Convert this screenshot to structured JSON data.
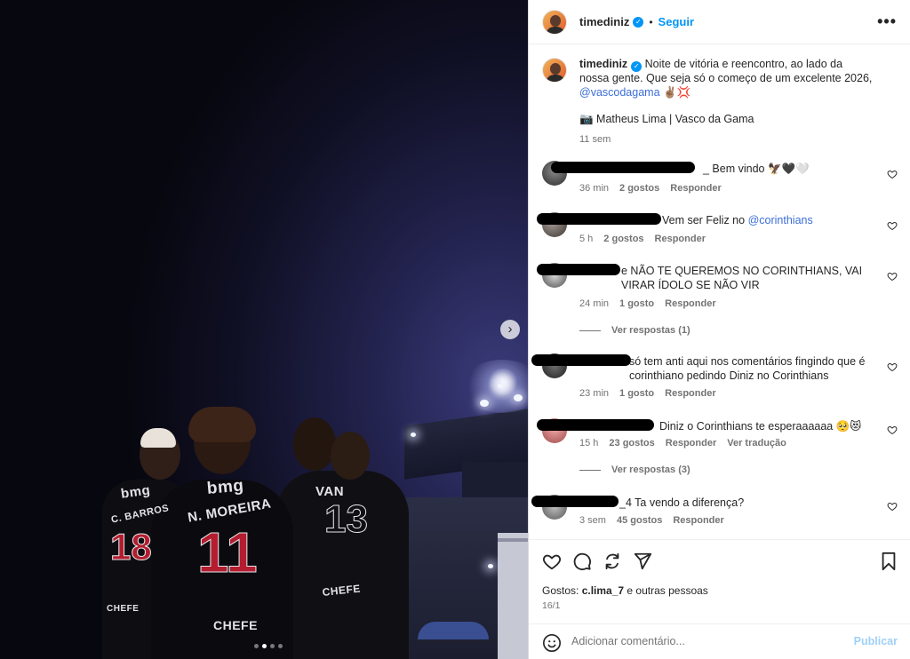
{
  "post": {
    "username": "timediniz",
    "follow_label": "Seguir",
    "more_label": "•••",
    "caption": {
      "username": "timediniz",
      "text": "Noite de vitória e reencontro, ao lado da nossa gente. Que seja só o começo de um excelente 2026,",
      "mention": "@vascodagama",
      "emojis": "✌🏽💢",
      "credit": "📷 Matheus Lima | Vasco da Gama",
      "time_ago": "11 sem"
    },
    "photo": {
      "jersey_sponsor": "bmg",
      "jersey_name_left": "C. BARROS",
      "jersey_num_left": "18",
      "jersey_name_mid": "N. MOREIRA",
      "jersey_num_mid": "11",
      "jersey_name_right": "VAN",
      "jersey_num_right": "13",
      "jersey_partner": "CHEFE",
      "carousel_next": "›",
      "dots_total": 4,
      "dots_active": 2
    }
  },
  "comments": [
    {
      "text": "_ Bem vindo 🦅🖤🤍",
      "time": "36 min",
      "likes": "2 gostos",
      "reply": "Responder"
    },
    {
      "text": "Vem ser Feliz no ",
      "mention": "@corinthians",
      "time": "5 h",
      "likes": "2 gostos",
      "reply": "Responder"
    },
    {
      "text": "e NÃO TE QUEREMOS NO CORINTHIANS, VAI VIRAR ÍDOLO SE NÃO VIR",
      "time": "24 min",
      "likes": "1 gosto",
      "reply": "Responder",
      "replies": "Ver respostas (1)"
    },
    {
      "text": "só tem anti aqui nos comentários fingindo que é corinthiano pedindo Diniz no Corinthians",
      "time": "23 min",
      "likes": "1 gosto",
      "reply": "Responder"
    },
    {
      "text": "Diniz o Corinthians te esperaaaaaa 🥺😻",
      "time": "15 h",
      "likes": "23 gostos",
      "reply": "Responder",
      "translate": "Ver tradução",
      "replies": "Ver respostas (3)"
    },
    {
      "text": "_4 Ta vendo a diferença?",
      "time": "3 sem",
      "likes": "45 gostos",
      "reply": "Responder"
    }
  ],
  "footer": {
    "likes_prefix": "Gostos:",
    "liked_by": "c.lima_7",
    "likes_suffix": "e outras pessoas",
    "date": "16/1",
    "comment_placeholder": "Adicionar comentário...",
    "publish_label": "Publicar"
  },
  "icons": [
    "heart-icon",
    "comment-icon",
    "share-icon",
    "send-icon",
    "bookmark-icon",
    "emoji-icon",
    "verified-icon",
    "more-icon",
    "chevron-right-icon"
  ]
}
